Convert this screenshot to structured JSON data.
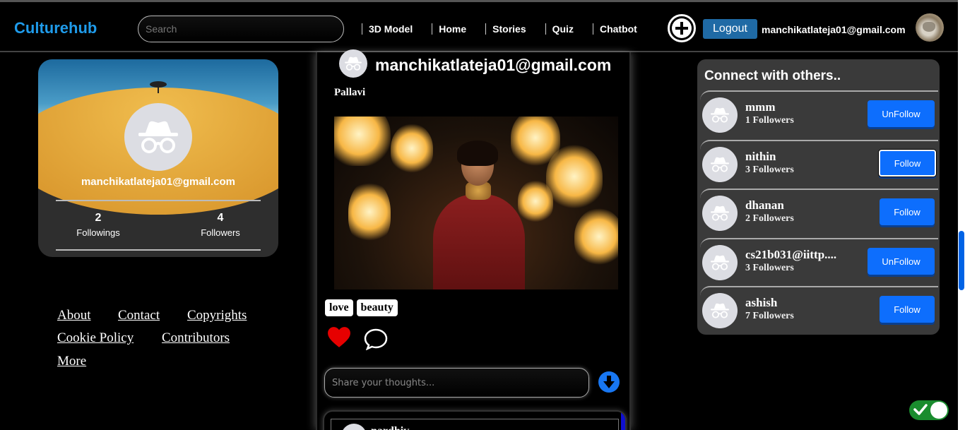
{
  "nav": {
    "brand": "Culturehub",
    "search_placeholder": "Search",
    "links": [
      "3D Model",
      "Home",
      "Stories",
      "Quiz",
      "Chatbot"
    ],
    "logout_label": "Logout",
    "user_email": "manchikatlateja01@gmail.com"
  },
  "profile": {
    "email": "manchikatlateja01@gmail.com",
    "followings_count": "2",
    "followings_label": "Followings",
    "followers_count": "4",
    "followers_label": "Followers"
  },
  "footer": {
    "links": [
      "About",
      "Contact",
      "Copyrights",
      "Cookie Policy",
      "Contributors",
      "More"
    ]
  },
  "post": {
    "username": "manchikatlateja01@gmail.com",
    "caption": "Pallavi",
    "tags": [
      "love",
      "beauty"
    ],
    "comment_placeholder": "Share your thoughts...",
    "first_comment_user": "nardhiv"
  },
  "connect": {
    "title": "Connect with others..",
    "users": [
      {
        "name": "mmm",
        "followers": "1 Followers",
        "button": "UnFollow"
      },
      {
        "name": "nithin",
        "followers": "3 Followers",
        "button": "Follow"
      },
      {
        "name": "dhanan",
        "followers": "2 Followers",
        "button": "Follow"
      },
      {
        "name": "cs21b031@iittp....",
        "followers": "3 Followers",
        "button": "UnFollow"
      },
      {
        "name": "ashish",
        "followers": "7 Followers",
        "button": "Follow"
      }
    ]
  },
  "theme": {
    "brand_color": "#1f9bea",
    "button_color": "#0d6efd",
    "logout_color": "#1f6aa5",
    "like_color": "#e60000",
    "toggle_on_color": "#1a8c2e"
  },
  "icons": {
    "add_post": "plus-circle-icon",
    "like": "heart-icon",
    "comment": "comment-icon",
    "send": "arrow-down-circle-icon",
    "theme_toggle": "check-icon",
    "default_avatar": "incognito-icon"
  }
}
